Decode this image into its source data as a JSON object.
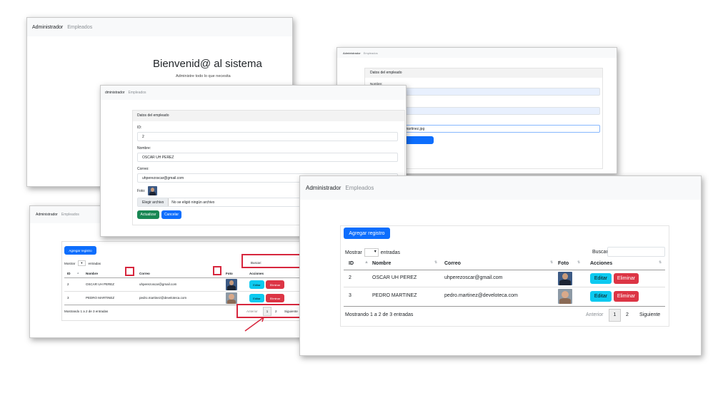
{
  "nav": {
    "brand": "Administrador",
    "link": "Empleados"
  },
  "window_b": {
    "brand_partial": "dministrador",
    "link": "Empleados"
  },
  "welcome": {
    "title": "Bienvenid@ al sistema",
    "subtitle": "Administre todo lo que necesita"
  },
  "form": {
    "header": "Datos del empleado",
    "id_label": "ID:",
    "id_value": "2",
    "nombre_label": "Nombre:",
    "nombre_value": "OSCAR UH PEREZ",
    "correo_label": "Correo:",
    "correo_value": "uhperezoscar@gmail.com",
    "foto_label": "Foto:",
    "file_button": "Elegir archivo",
    "file_status": "No se eligió ningún archivo",
    "update_button": "Actualizar",
    "cancel_button": "Cancelar"
  },
  "form_back": {
    "header": "Datos del empleado",
    "nombre_label": "Nombre:",
    "file_value": "martinez.jpg"
  },
  "table": {
    "add_button": "Agregar registro",
    "show_label": "Mostrar",
    "entries_label": "entradas",
    "search_label": "Buscar:",
    "columns": [
      "ID",
      "Nombre",
      "Correo",
      "Foto",
      "Acciones"
    ],
    "rows": [
      {
        "id": "2",
        "nombre": "OSCAR UH PEREZ",
        "correo": "uhperezoscar@gmail.com",
        "edit": "Editar",
        "delete": "Eliminar"
      },
      {
        "id": "3",
        "nombre": "PEDRO MARTINEZ",
        "correo": "pedro.martinez@develoteca.com",
        "edit": "Editar",
        "delete": "Eliminar"
      }
    ],
    "info": "Mostrando 1 a 2 de 3 entradas",
    "pager": {
      "prev": "Anterior",
      "page1": "1",
      "page2": "2",
      "next": "Siguiente"
    }
  },
  "colors": {
    "primary": "#0d6efd",
    "info": "#0dcaf0",
    "danger": "#dc3545",
    "success": "#198754",
    "annotation": "#d7263d"
  }
}
